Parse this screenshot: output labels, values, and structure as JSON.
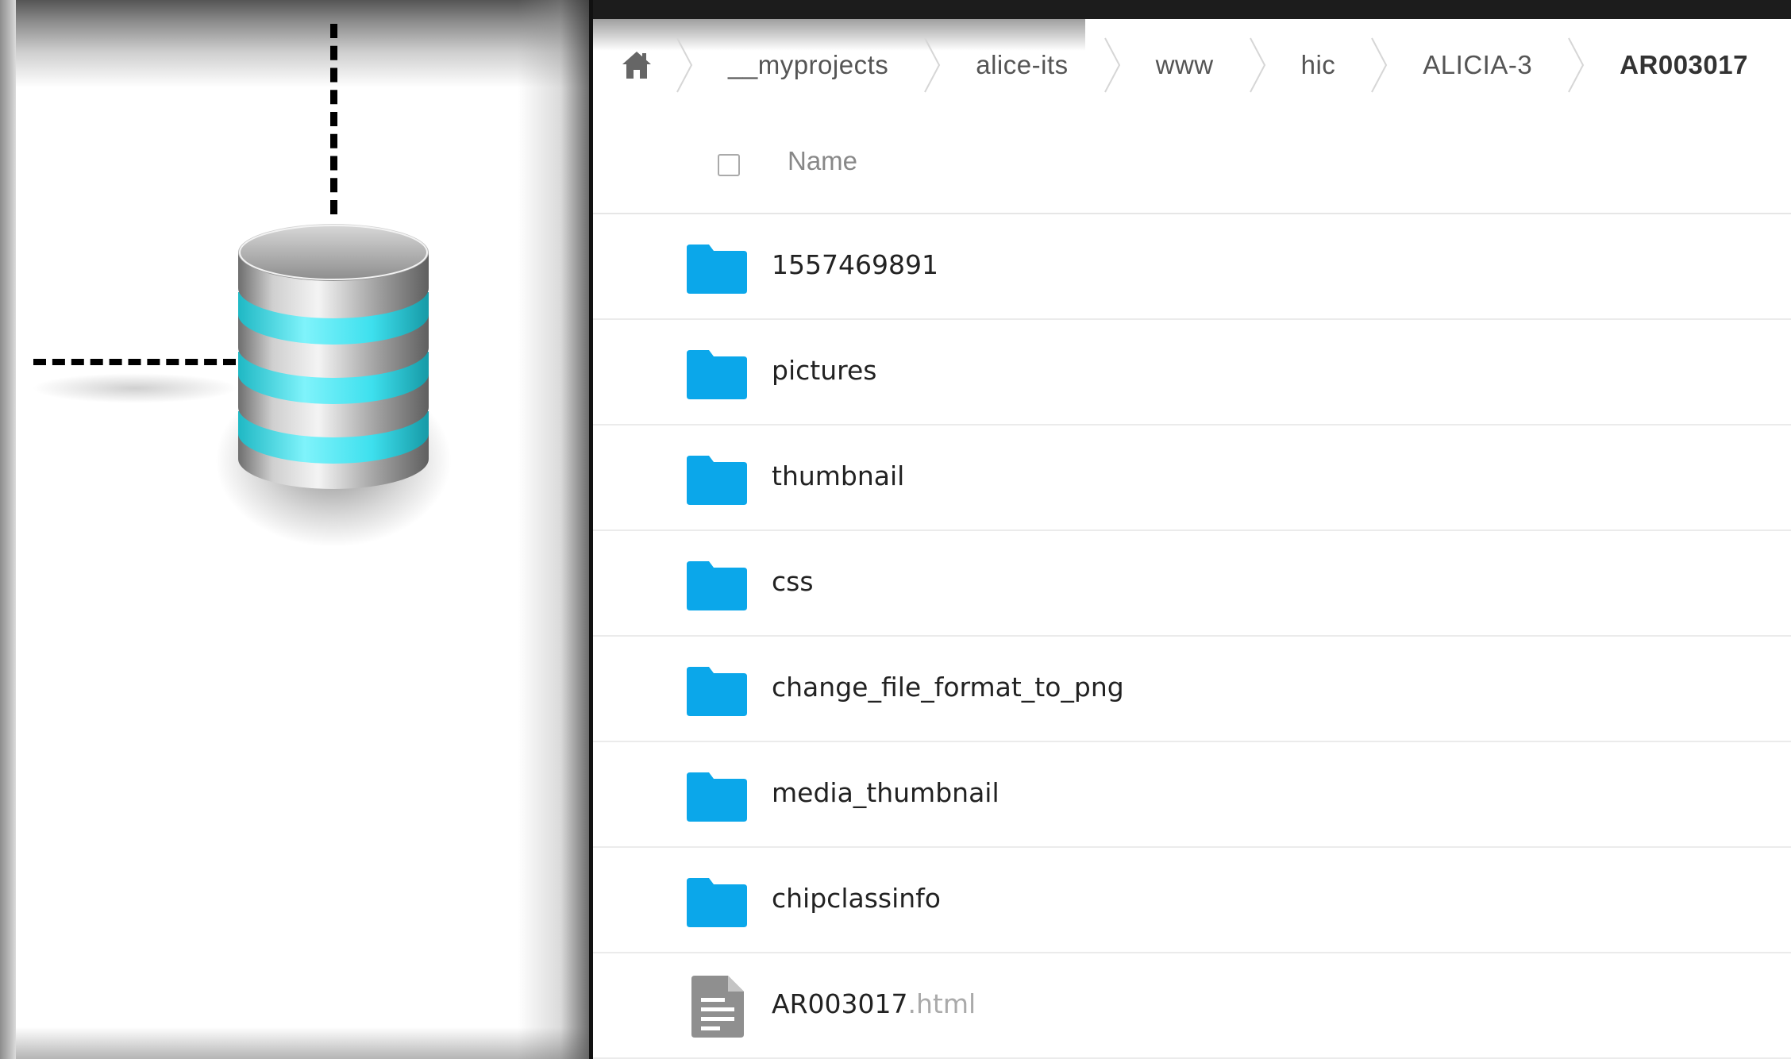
{
  "breadcrumb": {
    "home_icon": "home-icon",
    "items": [
      "__myprojects",
      "alice-its",
      "www",
      "hic",
      "ALICIA-3",
      "AR003017"
    ]
  },
  "table": {
    "columns": {
      "name": "Name"
    },
    "rows": [
      {
        "name": "1557469891",
        "type": "folder"
      },
      {
        "name": "pictures",
        "type": "folder"
      },
      {
        "name": "thumbnail",
        "type": "folder"
      },
      {
        "name": "css",
        "type": "folder"
      },
      {
        "name": "change_file_format_to_png",
        "type": "folder"
      },
      {
        "name": "media_thumbnail",
        "type": "folder"
      },
      {
        "name": "chipclassinfo",
        "type": "folder"
      },
      {
        "name": "AR003017",
        "extension": ".html",
        "type": "file"
      }
    ]
  },
  "colors": {
    "folder": "#0ba7ea",
    "database_accent": "#3ee0ee",
    "file_icon": "#8f8f8f"
  },
  "icons": {
    "database": "database-icon",
    "folder": "folder-icon",
    "file": "document-icon"
  }
}
